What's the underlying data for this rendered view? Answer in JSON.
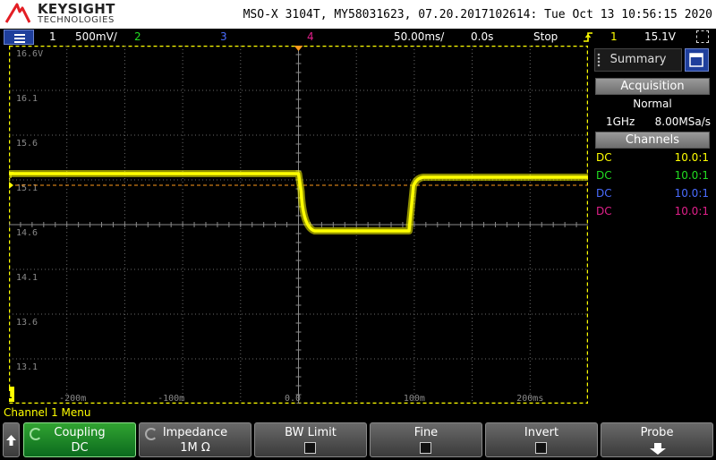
{
  "brand": {
    "name": "KEYSIGHT",
    "sub": "TECHNOLOGIES"
  },
  "instrument_info": "MSO-X 3104T, MY58031623, 07.20.2017102614: Tue Oct 13 10:56:15 2020",
  "status": {
    "ch1_num": "1",
    "ch1_scale": "500mV/",
    "ch2_num": "2",
    "ch3_num": "3",
    "ch4_num": "4",
    "timebase": "50.00ms/",
    "delay": "0.0s",
    "run_state": "Stop",
    "trig_channel": "1",
    "trig_level": "15.1V"
  },
  "graticule": {
    "y_labels": [
      "16.6V",
      "16.1",
      "15.6",
      "15.1",
      "14.6",
      "14.1",
      "13.6",
      "13.1"
    ],
    "x_labels": [
      "-200m",
      "-100m",
      "0.0",
      "100m",
      "200ms"
    ],
    "ground_marker": "1",
    "trigger_marker": "T"
  },
  "panel": {
    "summary_tab": "Summary",
    "acquisition_header": "Acquisition",
    "acq_mode": "Normal",
    "bandwidth": "1GHz",
    "sample_rate": "8.00MSa/s",
    "channels_header": "Channels",
    "channels": [
      {
        "coupling": "DC",
        "probe": "10.0:1",
        "color": "#ffff00"
      },
      {
        "coupling": "DC",
        "probe": "10.0:1",
        "color": "#22dd22"
      },
      {
        "coupling": "DC",
        "probe": "10.0:1",
        "color": "#4a6cff"
      },
      {
        "coupling": "DC",
        "probe": "10.0:1",
        "color": "#e0208a"
      }
    ]
  },
  "menu_title": "Channel 1 Menu",
  "softkeys": {
    "coupling_label": "Coupling",
    "coupling_value": "DC",
    "impedance_label": "Impedance",
    "impedance_value": "1M Ω",
    "bw_limit_label": "BW Limit",
    "fine_label": "Fine",
    "invert_label": "Invert",
    "probe_label": "Probe"
  },
  "colors": {
    "ch1": "#ffff00",
    "ch2": "#22dd22",
    "ch3": "#4a6cff",
    "ch4": "#e0208a",
    "trig": "#ff9a1a",
    "accent_blue": "#1f3f9c"
  }
}
